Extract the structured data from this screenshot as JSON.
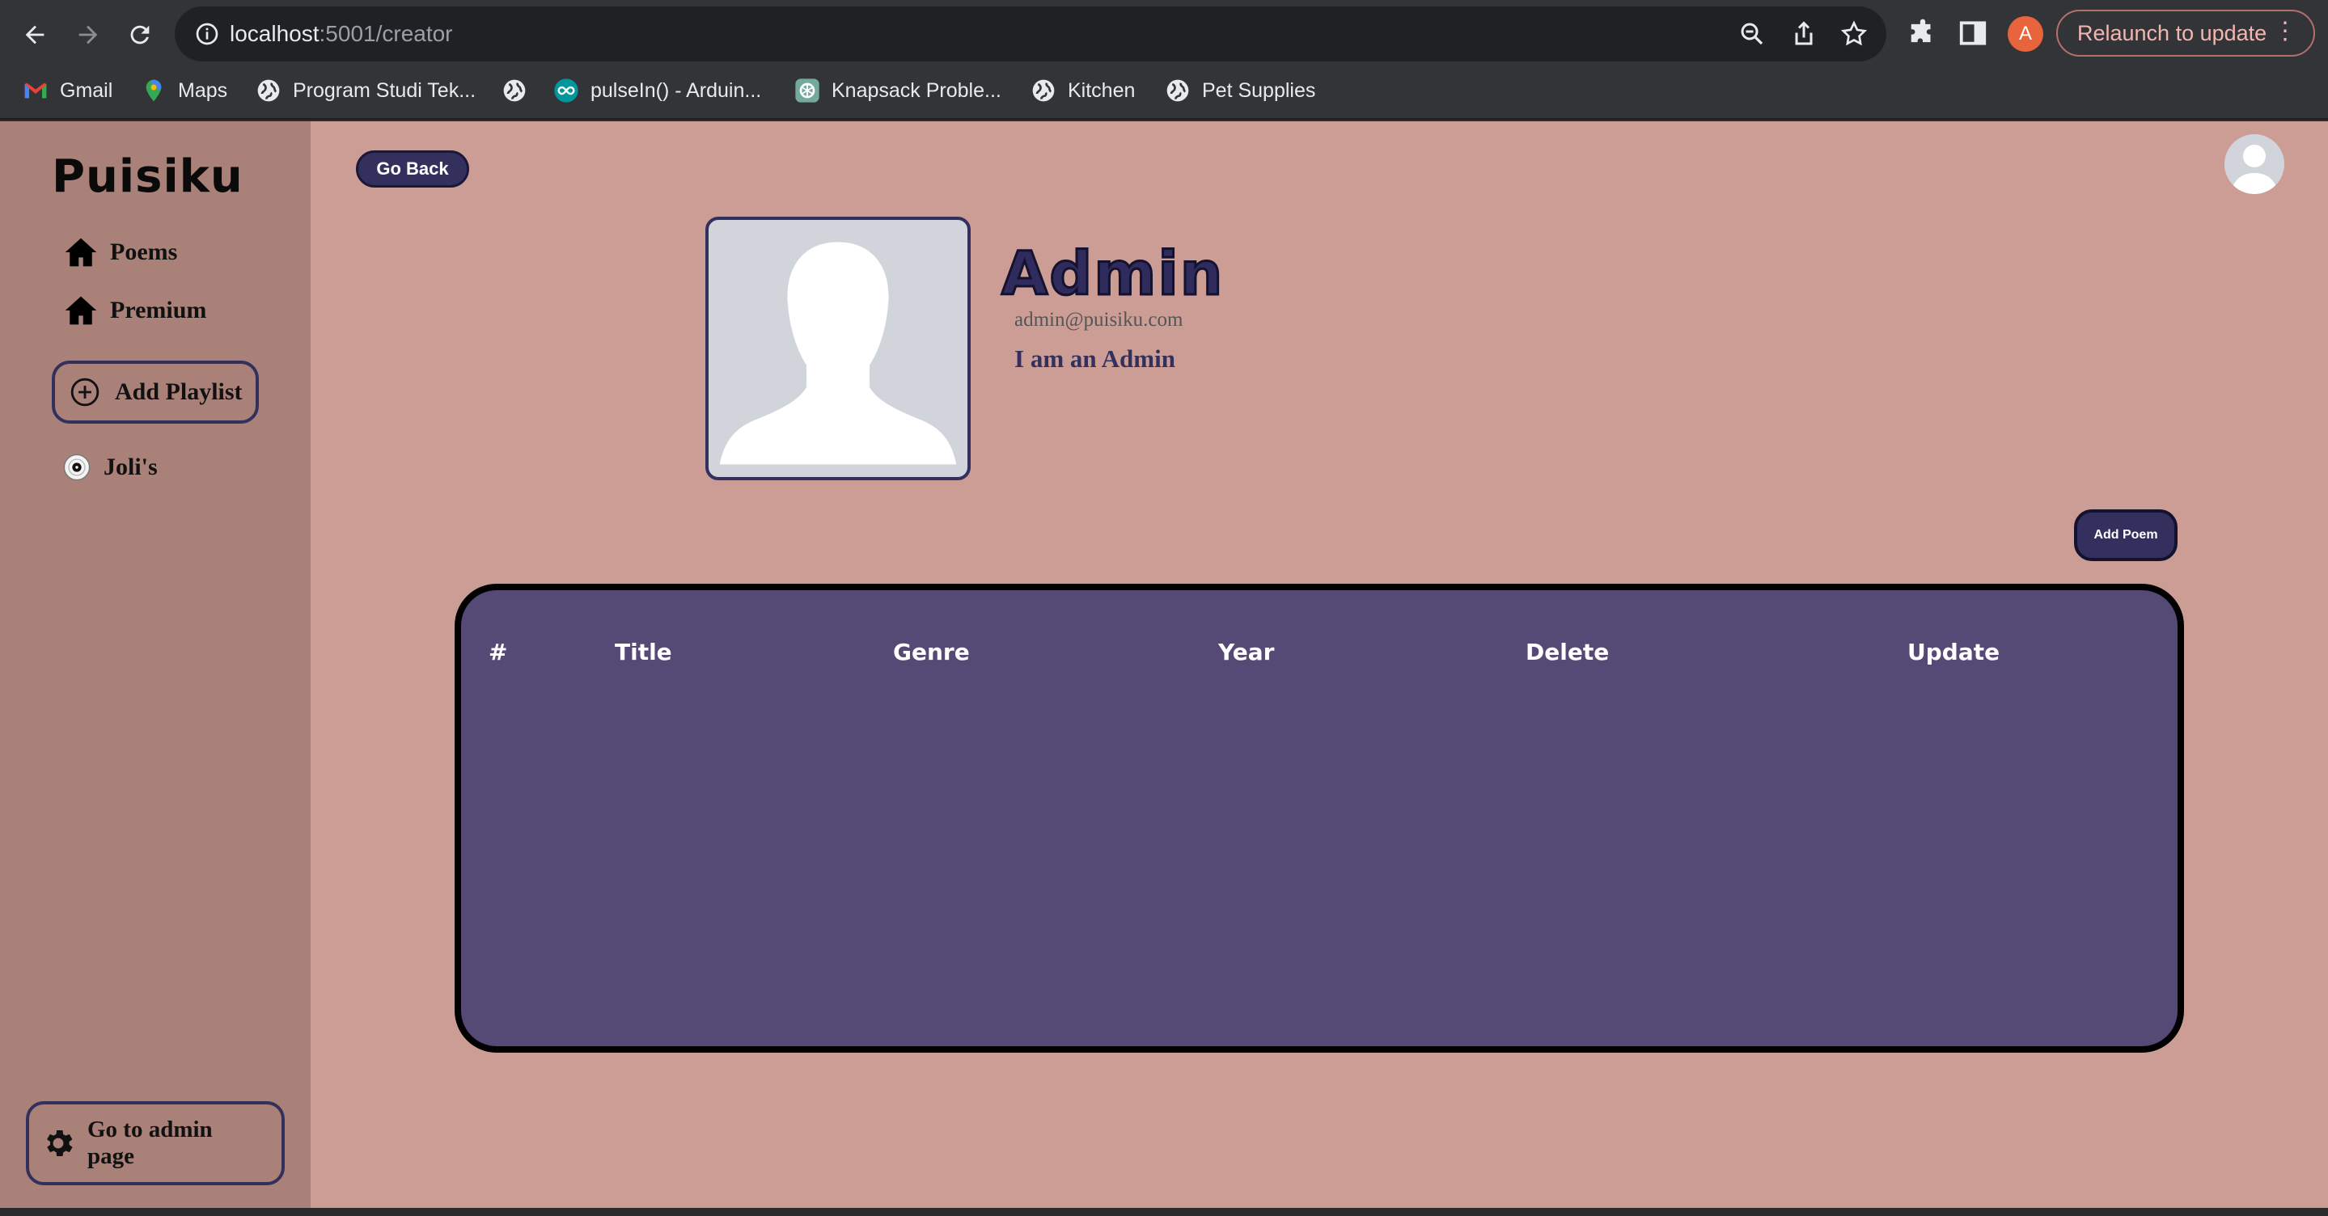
{
  "browser": {
    "url_host": "localhost",
    "url_path": ":5001/creator",
    "profile_initial": "A",
    "relaunch_label": "Relaunch to update",
    "bookmarks": [
      {
        "label": "Gmail",
        "icon": "gmail-icon"
      },
      {
        "label": "Maps",
        "icon": "maps-icon"
      },
      {
        "label": "Program Studi Tek...",
        "icon": "globe-icon"
      },
      {
        "label": "",
        "icon": "globe-icon"
      },
      {
        "label": "pulseIn() - Arduin...",
        "icon": "arduino-icon"
      },
      {
        "label": "Knapsack Proble...",
        "icon": "openai-icon"
      },
      {
        "label": "Kitchen",
        "icon": "globe-icon"
      },
      {
        "label": "Pet Supplies",
        "icon": "globe-icon"
      }
    ]
  },
  "sidebar": {
    "logo": "Puisiku",
    "links": [
      {
        "label": "Poems",
        "icon": "home-icon"
      },
      {
        "label": "Premium",
        "icon": "home-icon"
      }
    ],
    "add_playlist_label": "Add Playlist",
    "playlists": [
      {
        "label": "Joli's",
        "icon": "disc-icon"
      }
    ],
    "admin_label_line1": "Go to admin",
    "admin_label_line2": "page"
  },
  "main": {
    "go_back_label": "Go Back",
    "profile": {
      "name": "Admin",
      "email": "admin@puisiku.com",
      "bio": "I am an Admin"
    },
    "add_poem_label": "Add Poem",
    "table": {
      "headers": [
        "#",
        "Title",
        "Genre",
        "Year",
        "Delete",
        "Update"
      ],
      "rows": []
    }
  },
  "colors": {
    "app_bg": "#cc9d95",
    "sidebar_bg": "#a98178",
    "accent": "#34305e",
    "table_bg": "#554976"
  }
}
